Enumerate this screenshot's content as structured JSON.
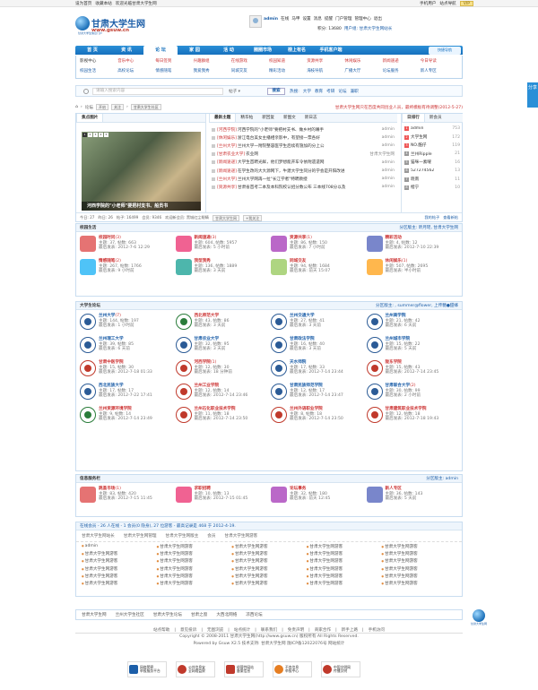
{
  "topbar": {
    "left": [
      "设为首页",
      "收藏本站",
      "欢迎光临甘肃大学生网"
    ],
    "right": [
      "手机用户",
      "站点导航"
    ],
    "vip": "VIP"
  },
  "logo": {
    "title": "甘肃大学生网",
    "url": "www.gsuw.cn",
    "slogan": "甘肃大学生信息门户"
  },
  "user": {
    "row1": [
      "admin",
      "在线",
      "马甲",
      "设置",
      "消息",
      "提醒",
      "门户管理",
      "管理中心",
      "退出"
    ],
    "row2": [
      "积分: 13680",
      "用户组: 甘肃大学生网站长"
    ]
  },
  "nav": {
    "items": [
      "首 页",
      "资 讯",
      "论 坛",
      "家 园",
      "活 动",
      "圈圈市场",
      "榜上有名",
      "手机客户端"
    ],
    "quick": "快捷导航"
  },
  "subnav": {
    "items": [
      "影视中心",
      "音乐中心",
      "每日签到",
      "兴趣群组",
      "在线游戏",
      "校园知道",
      "资源共享",
      "休闲娱乐",
      "新闻速递",
      "今日导读",
      "校园生活",
      "高校论坛",
      "情感随笔",
      "我爱我秀",
      "同城交友",
      "精彩活动",
      "海枝导航",
      "广播大厅",
      "论坛服务",
      "新人专区"
    ]
  },
  "search": {
    "placeholder": "请输入搜索内容",
    "type": "帖子",
    "button": "搜索",
    "hot_label": "热搜:",
    "hot": [
      "大学",
      "教育",
      "考研",
      "论坛",
      "兼职"
    ]
  },
  "crumb": {
    "home": "论坛",
    "open": "开启",
    "cancel": "关注",
    "site": "甘肃大学生社区",
    "notice": "甘肃大学生网只在百度共同创业人员，最终模板有待调整(2012-5-27)"
  },
  "focus": {
    "title": "焦点图片",
    "pages": [
      "1",
      "2",
      "3",
      "4",
      "5"
    ],
    "caption": "河西学院的\"小老师\"要把村支书、船员书"
  },
  "news_tabs": [
    "最新主题",
    "精华帖",
    "新回复",
    "新图文",
    "新日志"
  ],
  "news": [
    {
      "tag": "[河西学院]",
      "title": "河西学院的\"小老师\"要把村支书、做乡村的嘴手",
      "author": "admin"
    },
    {
      "tag": "[休闲娱乐]",
      "title": "浙江电台美女主播相亲影中，有望接一票各好",
      "author": "admin"
    },
    {
      "tag": "[兰州大学]",
      "title": "兰州大学一附院整容医学生后续有施加的分上公",
      "author": "admin"
    },
    {
      "tag": "[甘肃农业大学]",
      "title": "农业网",
      "author": "甘肃大学生网"
    },
    {
      "tag": "[新闻速递]",
      "title": "大学生首聘光鲜，他们梦想能开车令依附遗遗网",
      "author": "admin"
    },
    {
      "tag": "[新闻速递]",
      "title": "在学生改的大大源网下，牛建大学生同分的学会是开阳改进",
      "author": "admin"
    },
    {
      "tag": "[兰州大学]",
      "title": "兰州大学网再一拉\"长江学者\"特聘教授",
      "author": "admin"
    },
    {
      "tag": "[资源共享]",
      "title": "甘肃省首考二本及本科院校认招分数公布 三本线708分以及",
      "author": "admin"
    }
  ],
  "rank_tabs": [
    "日排行",
    "新会员"
  ],
  "rank": [
    {
      "n": "1",
      "name": "admin",
      "v": "753"
    },
    {
      "n": "2",
      "name": "大学生网",
      "v": "172"
    },
    {
      "n": "3",
      "name": "NO.酷仔",
      "v": "119"
    },
    {
      "n": "4",
      "name": "兰州Ripple",
      "v": "21"
    },
    {
      "n": "5",
      "name": "猫咪一素曜",
      "v": "16"
    },
    {
      "n": "6",
      "name": "527274562",
      "v": "13"
    },
    {
      "n": "7",
      "name": "晓南",
      "v": "11"
    },
    {
      "n": "8",
      "name": "楷宁",
      "v": "10"
    }
  ],
  "stats": {
    "today": "今日: 27",
    "yesterday": "昨日: 26",
    "posts": "帖子: 16499",
    "members": "会员: 9346",
    "welcome": "欢迎新会员: 黑城红尘眼睛",
    "link": "甘肃大学生网",
    "follow": "+我关注",
    "right": [
      "我的帖子",
      "查看新帖"
    ]
  },
  "campus_life": {
    "title": "校园生活",
    "moderators": "分区版主: 昕月瑶, 甘肃大学生网",
    "forums": [
      {
        "name": "校园时问",
        "count": "(3)",
        "meta": "主题: 37, 帖数: 663",
        "last": "最后发表: 2012-7-6 12:29"
      },
      {
        "name": "新闻速递",
        "count": "(3)",
        "meta": "主题: 604, 帖数: 5957",
        "last": "最后发表: 5 小时前"
      },
      {
        "name": "资源共享",
        "count": "(1)",
        "meta": "主题: 86, 帖数: 150",
        "last": "最后发表: 7 小时前"
      },
      {
        "name": "精彩活动",
        "count": "",
        "meta": "主题: 4, 帖数: 12",
        "last": "最后发表: 2012-7-10 22:39"
      },
      {
        "name": "情感随笔",
        "count": "(2)",
        "meta": "主题: 267, 帖数: 1766",
        "last": "最后发表: 9 小时前"
      },
      {
        "name": "我型我秀",
        "count": "",
        "meta": "主题: 136, 帖数: 1889",
        "last": "最后发表: 3 天前"
      },
      {
        "name": "同城交友",
        "count": "",
        "meta": "主题: 94, 帖数: 1684",
        "last": "最后发表: 前天 15:07"
      },
      {
        "name": "休闲娱乐",
        "count": "(1)",
        "meta": "主题: 507, 帖数: 2695",
        "last": "最后发表: 半小时前"
      }
    ]
  },
  "uni_forum": {
    "title": "大学生论坛",
    "moderators": "分区版主: , summer@flower, 上传糖●甜蜂",
    "forums": [
      {
        "name": "兰州大学",
        "count": "(7)",
        "meta": "主题: 144, 帖数: 197",
        "last": "最后发表: 1 小时前",
        "c": "b"
      },
      {
        "name": "西北师范大学",
        "count": "",
        "meta": "主题: 43, 帖数: 86",
        "last": "最后发表: 3 天前",
        "c": "g"
      },
      {
        "name": "兰州交通大学",
        "count": "",
        "meta": "主题: 27, 帖数: 41",
        "last": "最后发表: 3 天前",
        "c": "b"
      },
      {
        "name": "兰州商学院",
        "count": "",
        "meta": "主题: 21, 帖数: 42",
        "last": "最后发表: 6 天前",
        "c": "b"
      },
      {
        "name": "兰州理工大学",
        "count": "",
        "meta": "主题: 39, 帖数: 85",
        "last": "最后发表: 6 天前",
        "c": "b"
      },
      {
        "name": "甘肃农业大学",
        "count": "",
        "meta": "主题: 32, 帖数: 95",
        "last": "最后发表: 3 天前",
        "c": "b"
      },
      {
        "name": "甘肃政法学院",
        "count": "",
        "meta": "主题: 16, 帖数: 40",
        "last": "最后发表: 3 天前",
        "c": "b"
      },
      {
        "name": "兰州城市学院",
        "count": "",
        "meta": "主题: 15, 帖数: 22",
        "last": "最后发表: 5 天前",
        "c": "b"
      },
      {
        "name": "甘肃中医学院",
        "count": "",
        "meta": "主题: 15, 帖数: 30",
        "last": "最后发表: 2012-7-18 01:33",
        "c": "r"
      },
      {
        "name": "河西学院",
        "count": "(1)",
        "meta": "主题: 12, 帖数: 30",
        "last": "最后发表: 18 分钟前",
        "c": "r"
      },
      {
        "name": "天水师院",
        "count": "",
        "meta": "主题: 17, 帖数: 33",
        "last": "最后发表: 2012-7-14 23:44",
        "c": "b"
      },
      {
        "name": "陇东学院",
        "count": "",
        "meta": "主题: 15, 帖数: 43",
        "last": "最后发表: 2012-7-14 23:45",
        "c": "r"
      },
      {
        "name": "西北民族大学",
        "count": "",
        "meta": "主题: 17, 帖数: 17",
        "last": "最后发表: 2012-7-22 17:41",
        "c": "b"
      },
      {
        "name": "兰州工业学院",
        "count": "",
        "meta": "主题: 12, 帖数: 14",
        "last": "最后发表: 2012-7-14 23:46",
        "c": "r"
      },
      {
        "name": "甘肃民族师范学院",
        "count": "",
        "meta": "主题: 12, 帖数: 17",
        "last": "最后发表: 2012-7-14 23:47",
        "c": "b"
      },
      {
        "name": "甘肃联合大学",
        "count": "(2)",
        "meta": "主题: 30, 帖数: 99",
        "last": "最后发表: 2 小时前",
        "c": "b"
      },
      {
        "name": "兰州资源环境学院",
        "count": "",
        "meta": "主题: 9, 帖数: 14",
        "last": "最后发表: 2012-7-14 23:49",
        "c": "g"
      },
      {
        "name": "兰州石化职业技术学院",
        "count": "",
        "meta": "主题: 11, 帖数: 18",
        "last": "最后发表: 2012-7-14 23:50",
        "c": "r"
      },
      {
        "name": "兰州外语职业学院",
        "count": "",
        "meta": "主题: 8, 帖数: 18",
        "last": "最后发表: 2012-7-14 23:50",
        "c": "r"
      },
      {
        "name": "甘肃建筑职业技术学院",
        "count": "",
        "meta": "主题: 12, 帖数: 18",
        "last": "最后发表: 2012-7-18 19:43",
        "c": "r"
      }
    ]
  },
  "info_board": {
    "title": "信息服务栏",
    "moderators": "分区版主: admin",
    "forums": [
      {
        "name": "跳蚤市场",
        "count": "(1)",
        "meta": "主题: 83, 帖数: 420",
        "last": "最后发表: 2012-7-15 11:45"
      },
      {
        "name": "求职招聘",
        "count": "",
        "meta": "主题: 10, 帖数: 13",
        "last": "最后发表: 2012-7-15 01:45"
      },
      {
        "name": "论坛事务",
        "count": "",
        "meta": "主题: 32, 帖数: 180",
        "last": "最后发表: 前天 12:45"
      },
      {
        "name": "新人专区",
        "count": "",
        "meta": "主题: 36, 帖数: 143",
        "last": "最后发表: 5 天前"
      }
    ]
  },
  "online": {
    "header": "在线会员 - 26 人在线 - 1 会员(0 隐身), 27 位游客 - 最高记录是 468 于 2012-4-19.",
    "legend": [
      "甘肃大学生网站长",
      "甘肃大学生网管理",
      "甘肃大学生网版主",
      "会员",
      "甘肃大学生网游客"
    ],
    "users": [
      "admin",
      "甘肃大学生网游客",
      "甘肃大学生网游客",
      "甘肃大学生网游客",
      "甘肃大学生网游客",
      "甘肃大学生网游客",
      "甘肃大学生网游客",
      "甘肃大学生网游客",
      "甘肃大学生网游客",
      "甘肃大学生网游客",
      "甘肃大学生网游客",
      "甘肃大学生网游客",
      "甘肃大学生网游客",
      "甘肃大学生网游客",
      "甘肃大学生网游客",
      "甘肃大学生网游客",
      "甘肃大学生网游客",
      "甘肃大学生网游客",
      "甘肃大学生网游客",
      "甘肃大学生网游客",
      "甘肃大学生网游客",
      "甘肃大学生网游客",
      "甘肃大学生网游客",
      "甘肃大学生网游客",
      "甘肃大学生网游客",
      "甘肃大学生网游客",
      "甘肃大学生网游客",
      "甘肃大学生网游客",
      "甘肃大学生网游客",
      "甘肃大学生网游客"
    ]
  },
  "links": [
    "甘肃大学生网",
    "兰州大学生社区",
    "甘肃大学生论坛",
    "甘肃之窗",
    "大西北网络",
    "凉西论坛"
  ],
  "footer": {
    "nav": [
      "站点帮助",
      "意见投诉",
      "无图浏览",
      "站点统计",
      "联系我们",
      "免责声明",
      "商家合作",
      "新手上路",
      "手机访问"
    ],
    "copyright": "Copyright © 2008-2011 甘肃大学生网(http://www.gsuw.cn) 版权所有 All Rights Reserved.",
    "powered": "Powered by Gsuw X2.5 技术支持: 甘肃大学生网 陇ICP备12022076号  网站统计"
  },
  "certs": [
    {
      "a": "网络警察",
      "b": "举报服务平台"
    },
    {
      "a": "公共信息安",
      "b": "全网络监察"
    },
    {
      "a": "经营性网站",
      "b": "备案信息"
    },
    {
      "a": "不良信息",
      "b": "举报中心"
    },
    {
      "a": "中国文明网",
      "b": "传播文明"
    }
  ],
  "side_tab": "分享",
  "side_badge": "甘肃大学生网"
}
